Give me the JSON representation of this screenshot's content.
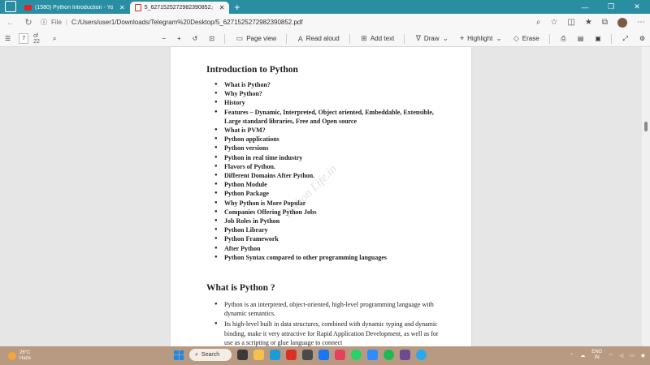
{
  "browser": {
    "tabs": [
      {
        "label": "(1580) Python Introduction - You",
        "close": "✕",
        "icon": "youtube-icon"
      },
      {
        "label": "5_6271525272982390852.pdf",
        "close": "✕",
        "icon": "pdf-icon"
      }
    ],
    "new_tab": "+",
    "address": {
      "scheme": "File",
      "url": "C:/Users/user1/Downloads/Telegram%20Desktop/5_6271525272982390852.pdf"
    }
  },
  "pdf_toolbar": {
    "page_number": "7",
    "page_total": "of 22",
    "page_view": "Page view",
    "read_aloud": "Read aloud",
    "add_text": "Add text",
    "draw": "Draw",
    "highlight": "Highlight",
    "erase": "Erase"
  },
  "document": {
    "heading": "Introduction to Python",
    "toc": [
      "What is Python?",
      "Why Python?",
      "History",
      "Features – Dynamic, Interpreted, Object oriented, Embeddable, Extensible, Large standard libraries, Free and Open source",
      "What is PVM?",
      "Python applications",
      "Python versions",
      "Python in real time industry",
      "Flavors of Python.",
      "Different Domains After Python.",
      "Python Module",
      "Python Package",
      "Why Python is More Popular",
      "Companies Offering Python Jobs",
      "Job Roles in Python",
      "Python Library",
      "Python Framework",
      "After Python",
      "Python Syntax compared to other programming languages"
    ],
    "section_heading": "What is Python ?",
    "section_points": [
      "Python is an interpreted, object-oriented, high-level programming language with dynamic semantics.",
      "Its high-level built in data structures, combined with dynamic typing and dynamic binding, make it very attractive for Rapid Application Development, as well as for use as a scripting or glue language to connect"
    ],
    "watermark": "Python Life.in"
  },
  "taskbar": {
    "temperature": "26°C",
    "condition": "Haze",
    "search": "Search",
    "lang_top": "ENG",
    "lang_bottom": "IN"
  }
}
